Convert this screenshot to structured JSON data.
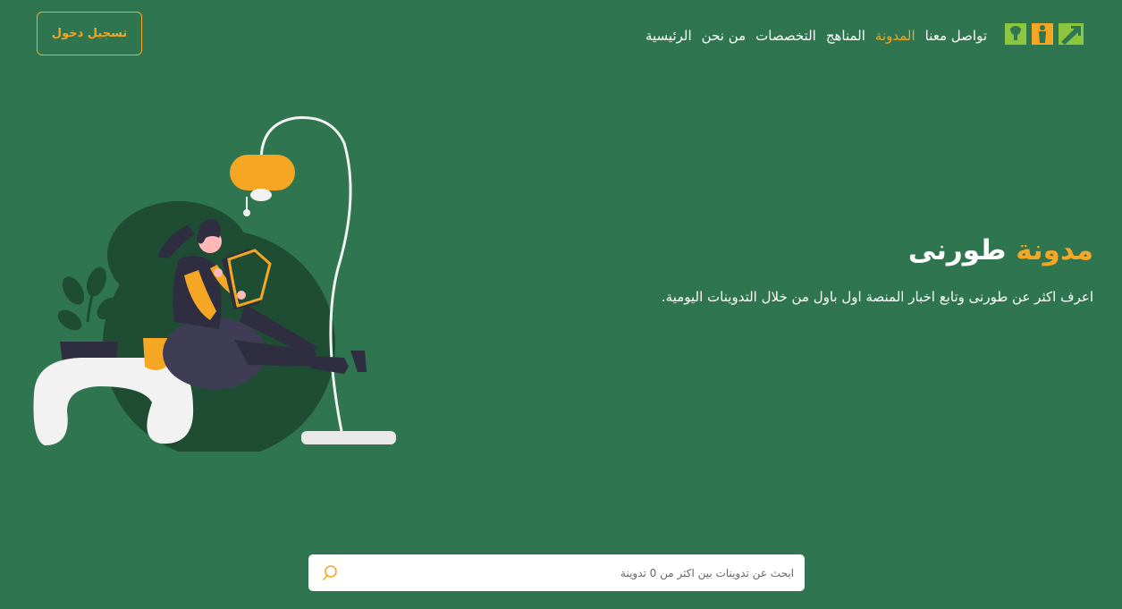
{
  "header": {
    "login_label": "تسجيل دخول",
    "logo_icon": "turny-logo-icon",
    "nav": [
      {
        "label": "الرئيسية",
        "active": false
      },
      {
        "label": "من نحن",
        "active": false
      },
      {
        "label": "التخصصات",
        "active": false
      },
      {
        "label": "المناهج",
        "active": false
      },
      {
        "label": "المدونة",
        "active": true
      },
      {
        "label": "تواصل معنا",
        "active": false
      }
    ]
  },
  "hero": {
    "title_accent": "مدونة",
    "title_main": "طورنى",
    "subtitle": "اعرف اكثر عن طورنى وتابع اخبار المنصة اول باول من خلال التدوينات اليومية.",
    "illustration": "woman-reading-under-lamp-illustration"
  },
  "search": {
    "placeholder": "ابحث عن تدوينات بين اكثر من 0 تدوينة",
    "value": "",
    "icon": "search-icon"
  },
  "colors": {
    "background": "#2e7550",
    "accent": "#f5a623",
    "text": "#ffffff",
    "logo_light_green": "#8cc63f"
  }
}
